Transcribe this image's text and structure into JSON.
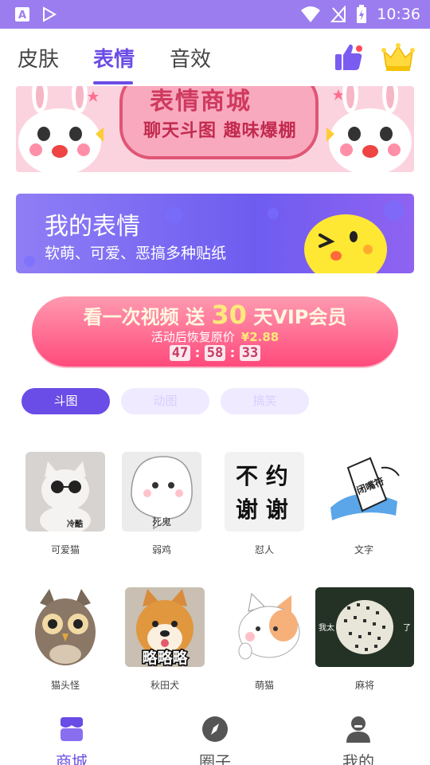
{
  "status_bar": {
    "time": "10:36"
  },
  "tabs": [
    {
      "label": "皮肤",
      "active": false
    },
    {
      "label": "表情",
      "active": true
    },
    {
      "label": "音效",
      "active": false
    }
  ],
  "banner_pink": {
    "title": "表情商城",
    "subtitle": "聊天斗图 趣味爆棚"
  },
  "banner_purple": {
    "title": "我的表情",
    "description": "软萌、可爱、恶搞多种贴纸"
  },
  "vip_banner": {
    "headline_pre": "看一次视频 送 ",
    "headline_num": "30",
    "headline_post": " 天VIP会员",
    "restore_text": "活动后恢复原价",
    "price": "¥2.88",
    "countdown": {
      "h": "47",
      "m": "58",
      "s": "33"
    }
  },
  "filters": [
    "斗图",
    "动图",
    "搞笑"
  ],
  "stickers": [
    {
      "label": "可爱猫",
      "caption": "冷酷"
    },
    {
      "label": "弱鸡",
      "caption": "死鬼"
    },
    {
      "label": "怼人",
      "caption": "不约 谢谢"
    },
    {
      "label": "文字",
      "caption": "闭嘴符"
    },
    {
      "label": "猫头怪",
      "caption": ""
    },
    {
      "label": "秋田犬",
      "caption": "略略略"
    },
    {
      "label": "萌猫",
      "caption": ""
    },
    {
      "label": "麻将",
      "caption": "我太 了"
    }
  ],
  "bottom_nav": [
    {
      "label": "商城",
      "active": true,
      "icon": "store-icon"
    },
    {
      "label": "圈子",
      "active": false,
      "icon": "compass-icon"
    },
    {
      "label": "我的",
      "active": false,
      "icon": "user-icon"
    }
  ],
  "colors": {
    "accent": "#6a4ce6",
    "status_bar": "#9b7df0"
  }
}
